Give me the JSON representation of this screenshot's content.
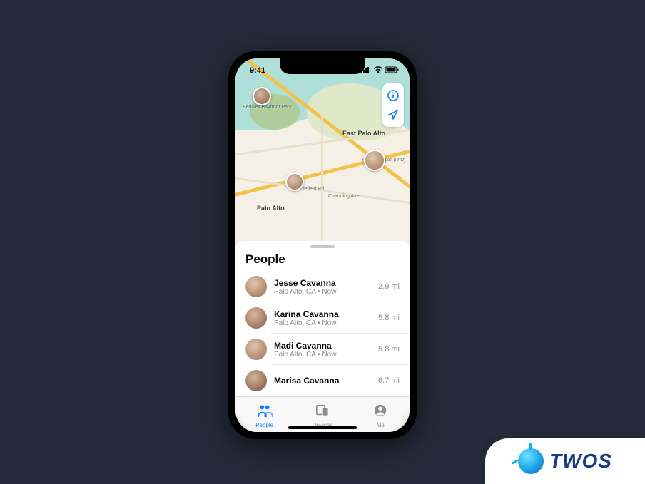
{
  "status": {
    "time": "9:41",
    "signal_icon": "signal-icon",
    "wifi_icon": "wifi-icon",
    "battery_icon": "battery-icon"
  },
  "map": {
    "labels": {
      "east_palo_alto": "East Palo\nAlto",
      "palo_alto": "Palo Alto",
      "bedwell": "Bedwell\nBayfront\nPark",
      "middlefield": "Middlefield Rd",
      "channing": "Channing Ave",
      "airport": "Palo Alto\nAirport (PAO)"
    },
    "controls": {
      "info_icon": "info-icon",
      "locate_icon": "location-arrow-icon"
    }
  },
  "sheet": {
    "title": "People",
    "people": [
      {
        "name": "Jesse Cavanna",
        "sub": "Palo Alto, CA • Now",
        "distance": "2.9 mi"
      },
      {
        "name": "Karina Cavanna",
        "sub": "Palo Alto, CA • Now",
        "distance": "5.8 mi"
      },
      {
        "name": "Madi Cavanna",
        "sub": "Palo Alto, CA • Now",
        "distance": "5.8 mi"
      },
      {
        "name": "Marisa Cavanna",
        "sub": "",
        "distance": "6.7 mi"
      }
    ]
  },
  "tabs": {
    "people": "People",
    "devices": "Devices",
    "me": "Me"
  },
  "brand": {
    "name": "TWOS"
  }
}
